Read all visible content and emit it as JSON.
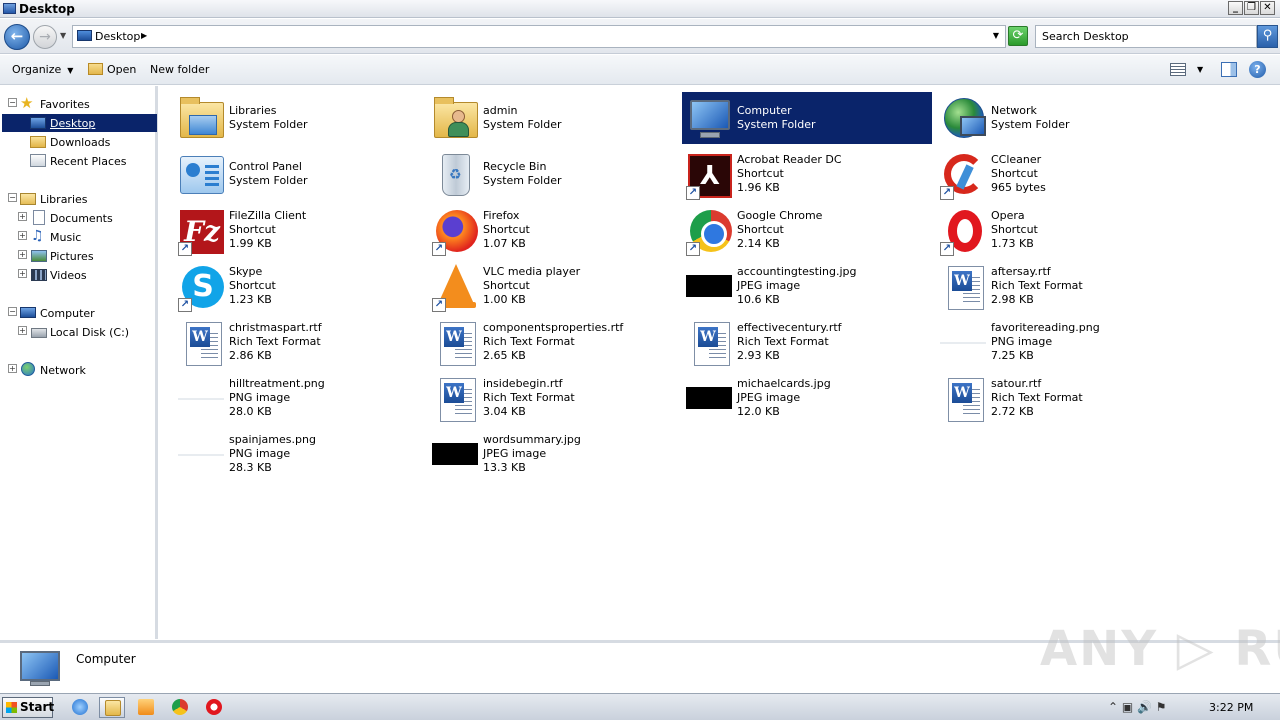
{
  "window": {
    "title": "Desktop",
    "min": "_",
    "restore": "❐",
    "close": "✕"
  },
  "address": {
    "crumb": "Desktop",
    "search_placeholder": "Search Desktop"
  },
  "toolbar": {
    "organize": "Organize",
    "open": "Open",
    "new_folder": "New folder"
  },
  "nav": {
    "favorites": "Favorites",
    "desktop": "Desktop",
    "downloads": "Downloads",
    "recent": "Recent Places",
    "libraries": "Libraries",
    "documents": "Documents",
    "music": "Music",
    "pictures": "Pictures",
    "videos": "Videos",
    "computer": "Computer",
    "local_disk": "Local Disk (C:)",
    "network": "Network"
  },
  "items": [
    {
      "name": "Libraries",
      "type": "System Folder",
      "size": "",
      "icon": "libraries-icon"
    },
    {
      "name": "admin",
      "type": "System Folder",
      "size": "",
      "icon": "user-folder-icon"
    },
    {
      "name": "Computer",
      "type": "System Folder",
      "size": "",
      "icon": "computer-icon",
      "selected": true
    },
    {
      "name": "Network",
      "type": "System Folder",
      "size": "",
      "icon": "network-icon"
    },
    {
      "name": "Control Panel",
      "type": "System Folder",
      "size": "",
      "icon": "control-panel-icon"
    },
    {
      "name": "Recycle Bin",
      "type": "System Folder",
      "size": "",
      "icon": "recycle-bin-icon"
    },
    {
      "name": "Acrobat Reader DC",
      "type": "Shortcut",
      "size": "1.96 KB",
      "icon": "acrobat-icon"
    },
    {
      "name": "CCleaner",
      "type": "Shortcut",
      "size": "965 bytes",
      "icon": "ccleaner-icon"
    },
    {
      "name": "FileZilla Client",
      "type": "Shortcut",
      "size": "1.99 KB",
      "icon": "filezilla-icon"
    },
    {
      "name": "Firefox",
      "type": "Shortcut",
      "size": "1.07 KB",
      "icon": "firefox-icon"
    },
    {
      "name": "Google Chrome",
      "type": "Shortcut",
      "size": "2.14 KB",
      "icon": "chrome-icon"
    },
    {
      "name": "Opera",
      "type": "Shortcut",
      "size": "1.73 KB",
      "icon": "opera-icon"
    },
    {
      "name": "Skype",
      "type": "Shortcut",
      "size": "1.23 KB",
      "icon": "skype-icon"
    },
    {
      "name": "VLC media player",
      "type": "Shortcut",
      "size": "1.00 KB",
      "icon": "vlc-icon"
    },
    {
      "name": "accountingtesting.jpg",
      "type": "JPEG image",
      "size": "10.6 KB",
      "icon": "jpeg-thumbnail-icon"
    },
    {
      "name": "aftersay.rtf",
      "type": "Rich Text Format",
      "size": "2.98 KB",
      "icon": "rtf-document-icon"
    },
    {
      "name": "christmaspart.rtf",
      "type": "Rich Text Format",
      "size": "2.86 KB",
      "icon": "rtf-document-icon"
    },
    {
      "name": "componentsproperties.rtf",
      "type": "Rich Text Format",
      "size": "2.65 KB",
      "icon": "rtf-document-icon"
    },
    {
      "name": "effectivecentury.rtf",
      "type": "Rich Text Format",
      "size": "2.93 KB",
      "icon": "rtf-document-icon"
    },
    {
      "name": "favoritereading.png",
      "type": "PNG image",
      "size": "7.25 KB",
      "icon": "png-thumbnail-icon"
    },
    {
      "name": "hilltreatment.png",
      "type": "PNG image",
      "size": "28.0 KB",
      "icon": "png-thumbnail-icon"
    },
    {
      "name": "insidebegin.rtf",
      "type": "Rich Text Format",
      "size": "3.04 KB",
      "icon": "rtf-document-icon"
    },
    {
      "name": "michaelcards.jpg",
      "type": "JPEG image",
      "size": "12.0 KB",
      "icon": "jpeg-thumbnail-icon"
    },
    {
      "name": "satour.rtf",
      "type": "Rich Text Format",
      "size": "2.72 KB",
      "icon": "rtf-document-icon"
    },
    {
      "name": "spainjames.png",
      "type": "PNG image",
      "size": "28.3 KB",
      "icon": "png-thumbnail-icon"
    },
    {
      "name": "wordsummary.jpg",
      "type": "JPEG image",
      "size": "13.3 KB",
      "icon": "jpeg-thumbnail-icon"
    }
  ],
  "details": {
    "name": "Computer",
    "watermark": "ANY ▷ RUN"
  },
  "taskbar": {
    "start": "Start",
    "clock": "3:22 PM",
    "tray": "⌃ ▣ 🔊 ⚑"
  },
  "colors": {
    "selection": "#0a246a",
    "titlebar": "#dfe3ea"
  }
}
